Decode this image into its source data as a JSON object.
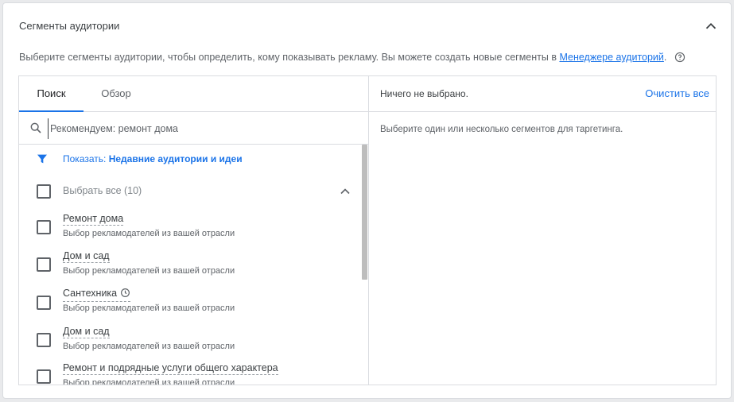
{
  "section": {
    "title": "Сегменты аудитории",
    "description": "Выберите сегменты аудитории, чтобы определить, кому показывать рекламу. Вы можете создать новые сегменты в ",
    "link_text": "Менеджере аудиторий",
    "description_end": "."
  },
  "tabs": [
    {
      "label": "Поиск",
      "active": true
    },
    {
      "label": "Обзор",
      "active": false
    }
  ],
  "search": {
    "placeholder": "Рекомендуем: ремонт дома",
    "value": ""
  },
  "filter": {
    "prefix": "Показать: ",
    "value": "Недавние аудитории и идеи"
  },
  "select_all": {
    "label": "Выбрать все (10)"
  },
  "items": [
    {
      "title": "Ремонт дома",
      "subtitle": "Выбор рекламодателей из вашей отрасли",
      "icon": null
    },
    {
      "title": "Дом и сад",
      "subtitle": "Выбор рекламодателей из вашей отрасли",
      "icon": null
    },
    {
      "title": "Сантехника",
      "subtitle": "Выбор рекламодателей из вашей отрасли",
      "icon": "clock-icon"
    },
    {
      "title": "Дом и сад",
      "subtitle": "Выбор рекламодателей из вашей отрасли",
      "icon": null
    },
    {
      "title": "Ремонт и подрядные услуги общего характера",
      "subtitle": "Выбор рекламодателей из вашей отрасли",
      "icon": null
    }
  ],
  "selection": {
    "status": "Ничего не выбрано.",
    "clear_label": "Очистить все",
    "hint": "Выберите один или несколько сегментов для таргетинга."
  },
  "colors": {
    "accent": "#1a73e8",
    "text": "#3c4043",
    "muted": "#5f6368",
    "border": "#dadce0"
  }
}
